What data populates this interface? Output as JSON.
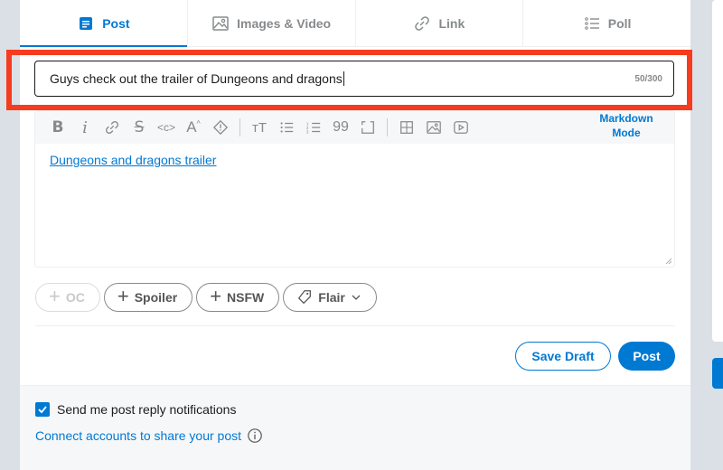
{
  "tabs": [
    {
      "label": "Post",
      "icon": "post-icon",
      "active": true
    },
    {
      "label": "Images & Video",
      "icon": "image-icon",
      "active": false
    },
    {
      "label": "Link",
      "icon": "link-icon",
      "active": false
    },
    {
      "label": "Poll",
      "icon": "poll-icon",
      "active": false
    }
  ],
  "title_input": {
    "value": "Guys check out the trailer of Dungeons and dragons",
    "counter": "50/300"
  },
  "toolbar": {
    "markdown_mode_line1": "Markdown",
    "markdown_mode_line2": "Mode",
    "icons": [
      "bold-icon",
      "italic-icon",
      "link-icon",
      "strikethrough-icon",
      "inline-code-icon",
      "superscript-icon",
      "spoiler-icon",
      "heading-icon",
      "bulleted-list-icon",
      "numbered-list-icon",
      "quote-icon",
      "code-block-icon",
      "table-icon",
      "image-icon",
      "video-icon"
    ]
  },
  "editor": {
    "link_text": "Dungeons and dragons trailer"
  },
  "tags": {
    "oc": "OC",
    "spoiler": "Spoiler",
    "nsfw": "NSFW",
    "flair": "Flair"
  },
  "actions": {
    "save_draft": "Save Draft",
    "post": "Post"
  },
  "footer": {
    "notify_label": "Send me post reply notifications",
    "notify_checked": true,
    "connect_label": "Connect accounts to share your post"
  },
  "colors": {
    "accent": "#0079d3",
    "highlight": "#f73b1e",
    "muted": "#878a8c"
  }
}
